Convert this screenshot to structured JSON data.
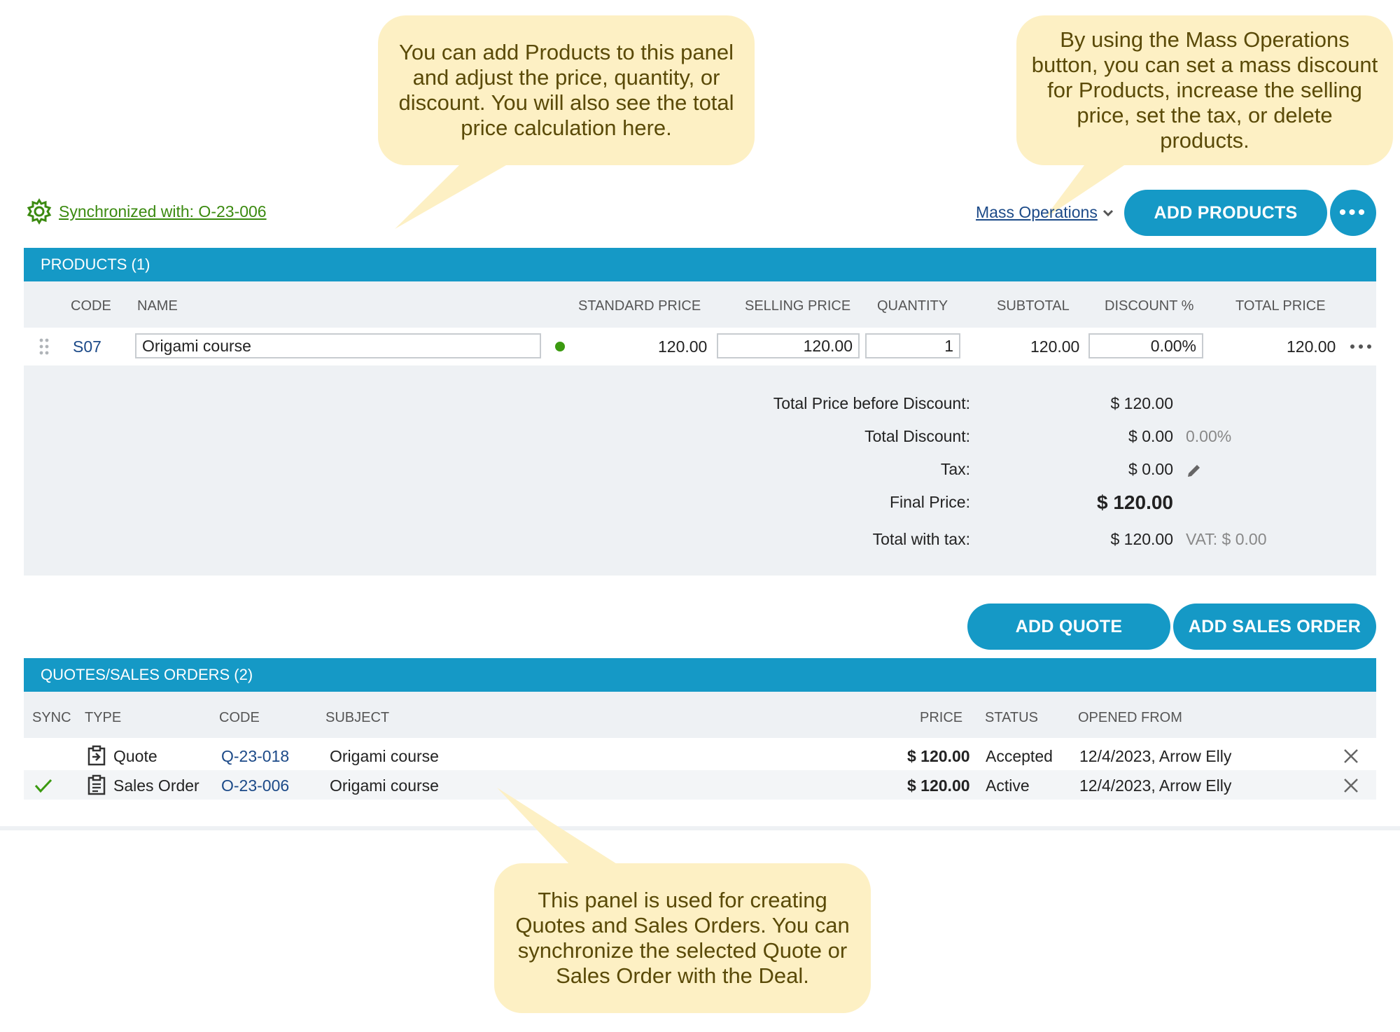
{
  "callouts": {
    "products": "You can add Products to this panel and adjust the price, quantity, or discount. You will also see the total price calculation here.",
    "mass": "By using the Mass Operations button, you can set a mass discount for Products, increase the selling price, set the tax, or delete products.",
    "quotes": "This panel is used for creating Quotes and Sales Orders. You can synchronize the selected Quote or Sales Order with the Deal."
  },
  "toolbar": {
    "sync_label": "Synchronized with: O-23-006",
    "mass_operations": "Mass Operations",
    "add_products": "ADD PRODUCTS",
    "more": "•••"
  },
  "products_panel": {
    "title": "PRODUCTS (1)",
    "columns": {
      "code": "CODE",
      "name": "NAME",
      "standard_price": "STANDARD PRICE",
      "selling_price": "SELLING PRICE",
      "quantity": "QUANTITY",
      "subtotal": "SUBTOTAL",
      "discount": "DISCOUNT %",
      "total_price": "TOTAL PRICE"
    },
    "rows": [
      {
        "code": "S07",
        "name": "Origami course",
        "standard_price": "120.00",
        "selling_price": "120.00",
        "quantity": "1",
        "subtotal": "120.00",
        "discount": "0.00%",
        "total_price": "120.00"
      }
    ],
    "totals": {
      "before_discount_label": "Total Price before Discount:",
      "before_discount_value": "$ 120.00",
      "discount_label": "Total Discount:",
      "discount_value": "$ 0.00",
      "discount_percent": "0.00%",
      "tax_label": "Tax:",
      "tax_value": "$ 0.00",
      "final_label": "Final Price:",
      "final_value": "$ 120.00",
      "with_tax_label": "Total with tax:",
      "with_tax_value": "$ 120.00",
      "vat": "VAT: $ 0.00"
    }
  },
  "quote_buttons": {
    "add_quote": "ADD QUOTE",
    "add_sales_order": "ADD SALES ORDER"
  },
  "quotes_panel": {
    "title": "QUOTES/SALES ORDERS (2)",
    "columns": {
      "sync": "SYNC",
      "type": "TYPE",
      "code": "CODE",
      "subject": "SUBJECT",
      "price": "PRICE",
      "status": "STATUS",
      "opened_from": "OPENED FROM"
    },
    "rows": [
      {
        "type": "Quote",
        "code": "Q-23-018",
        "subject": "Origami course",
        "price": "$ 120.00",
        "status": "Accepted",
        "opened_from": "12/4/2023, Arrow Elly"
      },
      {
        "type": "Sales Order",
        "code": "O-23-006",
        "subject": "Origami course",
        "price": "$ 120.00",
        "status": "Active",
        "opened_from": "12/4/2023, Arrow Elly"
      }
    ]
  },
  "colors": {
    "accent": "#1599c6",
    "link": "#1c4a88",
    "sync_green": "#3b8a10",
    "callout_bg": "#fdf0c4",
    "panel_bg": "#eef1f4"
  }
}
